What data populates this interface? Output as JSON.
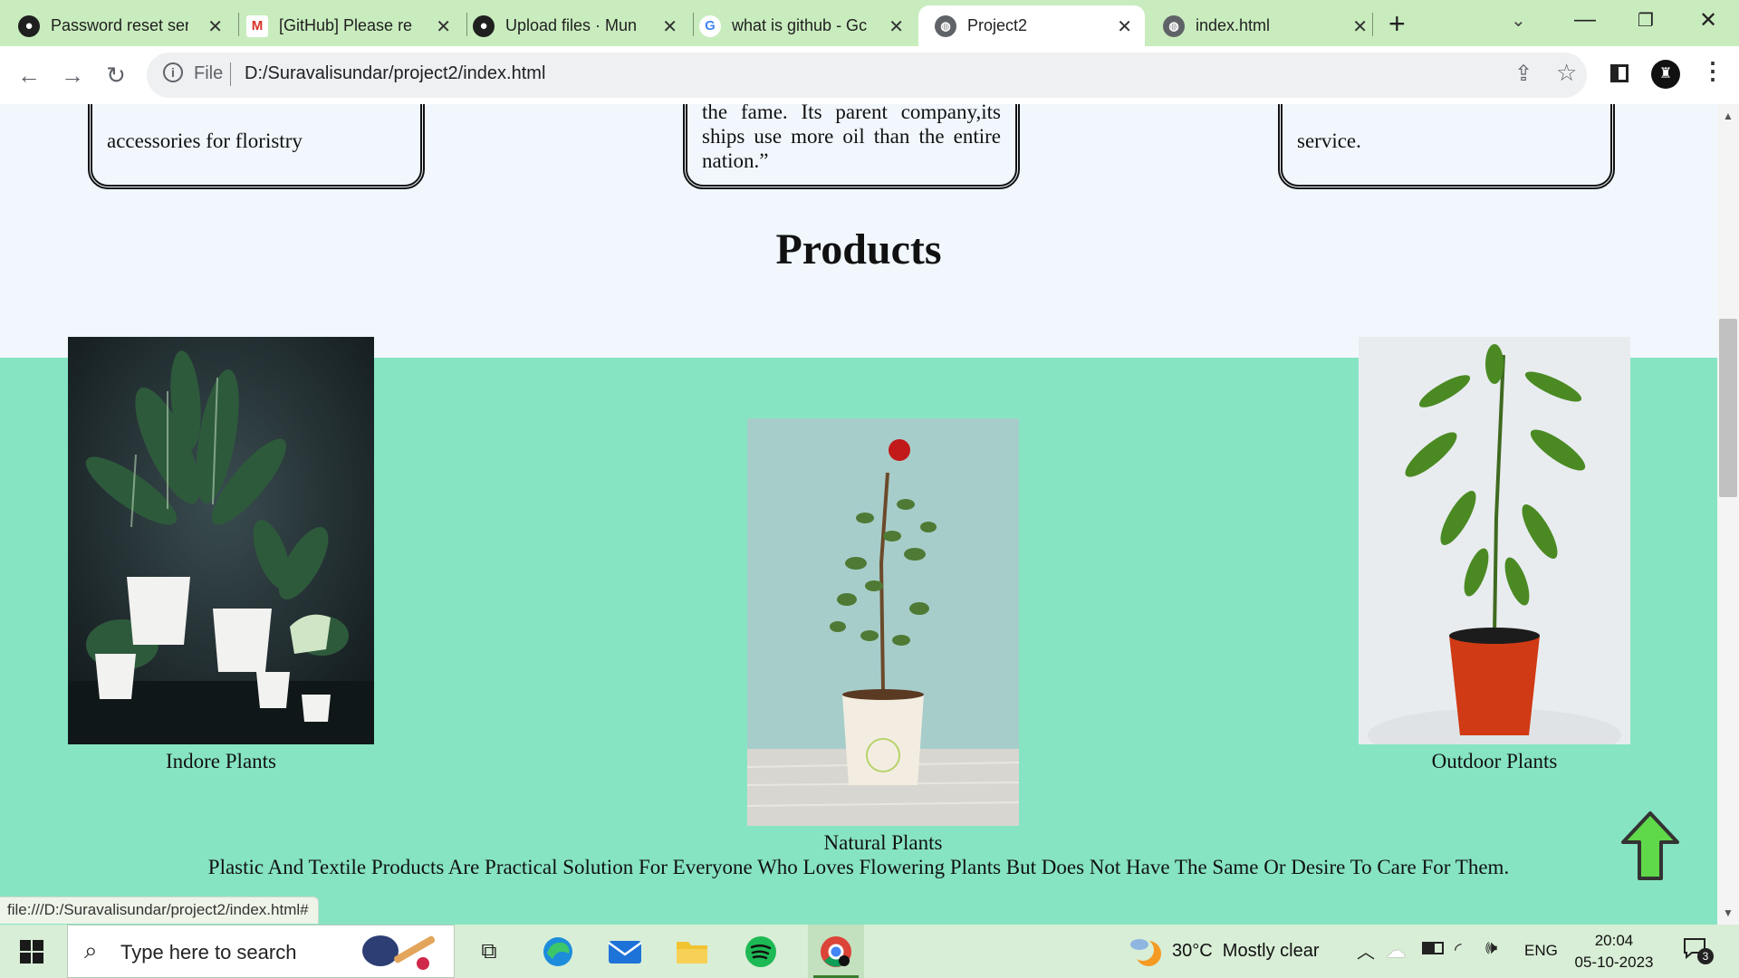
{
  "browser": {
    "tabs": [
      {
        "title": "Password reset ser",
        "icon": "github-icon"
      },
      {
        "title": "[GitHub] Please re",
        "icon": "gmail-icon"
      },
      {
        "title": "Upload files · Mun",
        "icon": "github-icon"
      },
      {
        "title": "what is github - Gc",
        "icon": "google-icon"
      },
      {
        "title": "Project2",
        "icon": "globe-icon",
        "active": true
      },
      {
        "title": "index.html",
        "icon": "globe-icon"
      }
    ],
    "address_scheme": "File",
    "address_url": "D:/Suravalisundar/project2/index.html",
    "status_url": "file:///D:/Suravalisundar/project2/index.html#"
  },
  "page": {
    "cards": [
      {
        "text": "accessories for floristry"
      },
      {
        "text": "the fame. Its parent company,its ships use more oil than the entire nation.”"
      },
      {
        "text": "service."
      }
    ],
    "products_title": "Products",
    "products": [
      {
        "caption": "Indore Plants"
      },
      {
        "caption": "Natural Plants"
      },
      {
        "caption": "Outdoor Plants"
      }
    ],
    "footer_note": "Plastic And Textile Products Are Practical Solution For Everyone Who Loves Flowering Plants But Does Not Have The Same Or Desire To Care For Them."
  },
  "taskbar": {
    "search_placeholder": "Type here to search",
    "weather": "30°C  Mostly clear",
    "language": "ENG",
    "time": "20:04",
    "date": "05-10-2023",
    "notifications": "3"
  },
  "colors": {
    "tab_strip": "#c9ecbe",
    "products_band": "#86e4c3",
    "page_bg": "#f1f7fd",
    "arrow_green": "#5fd84a"
  }
}
